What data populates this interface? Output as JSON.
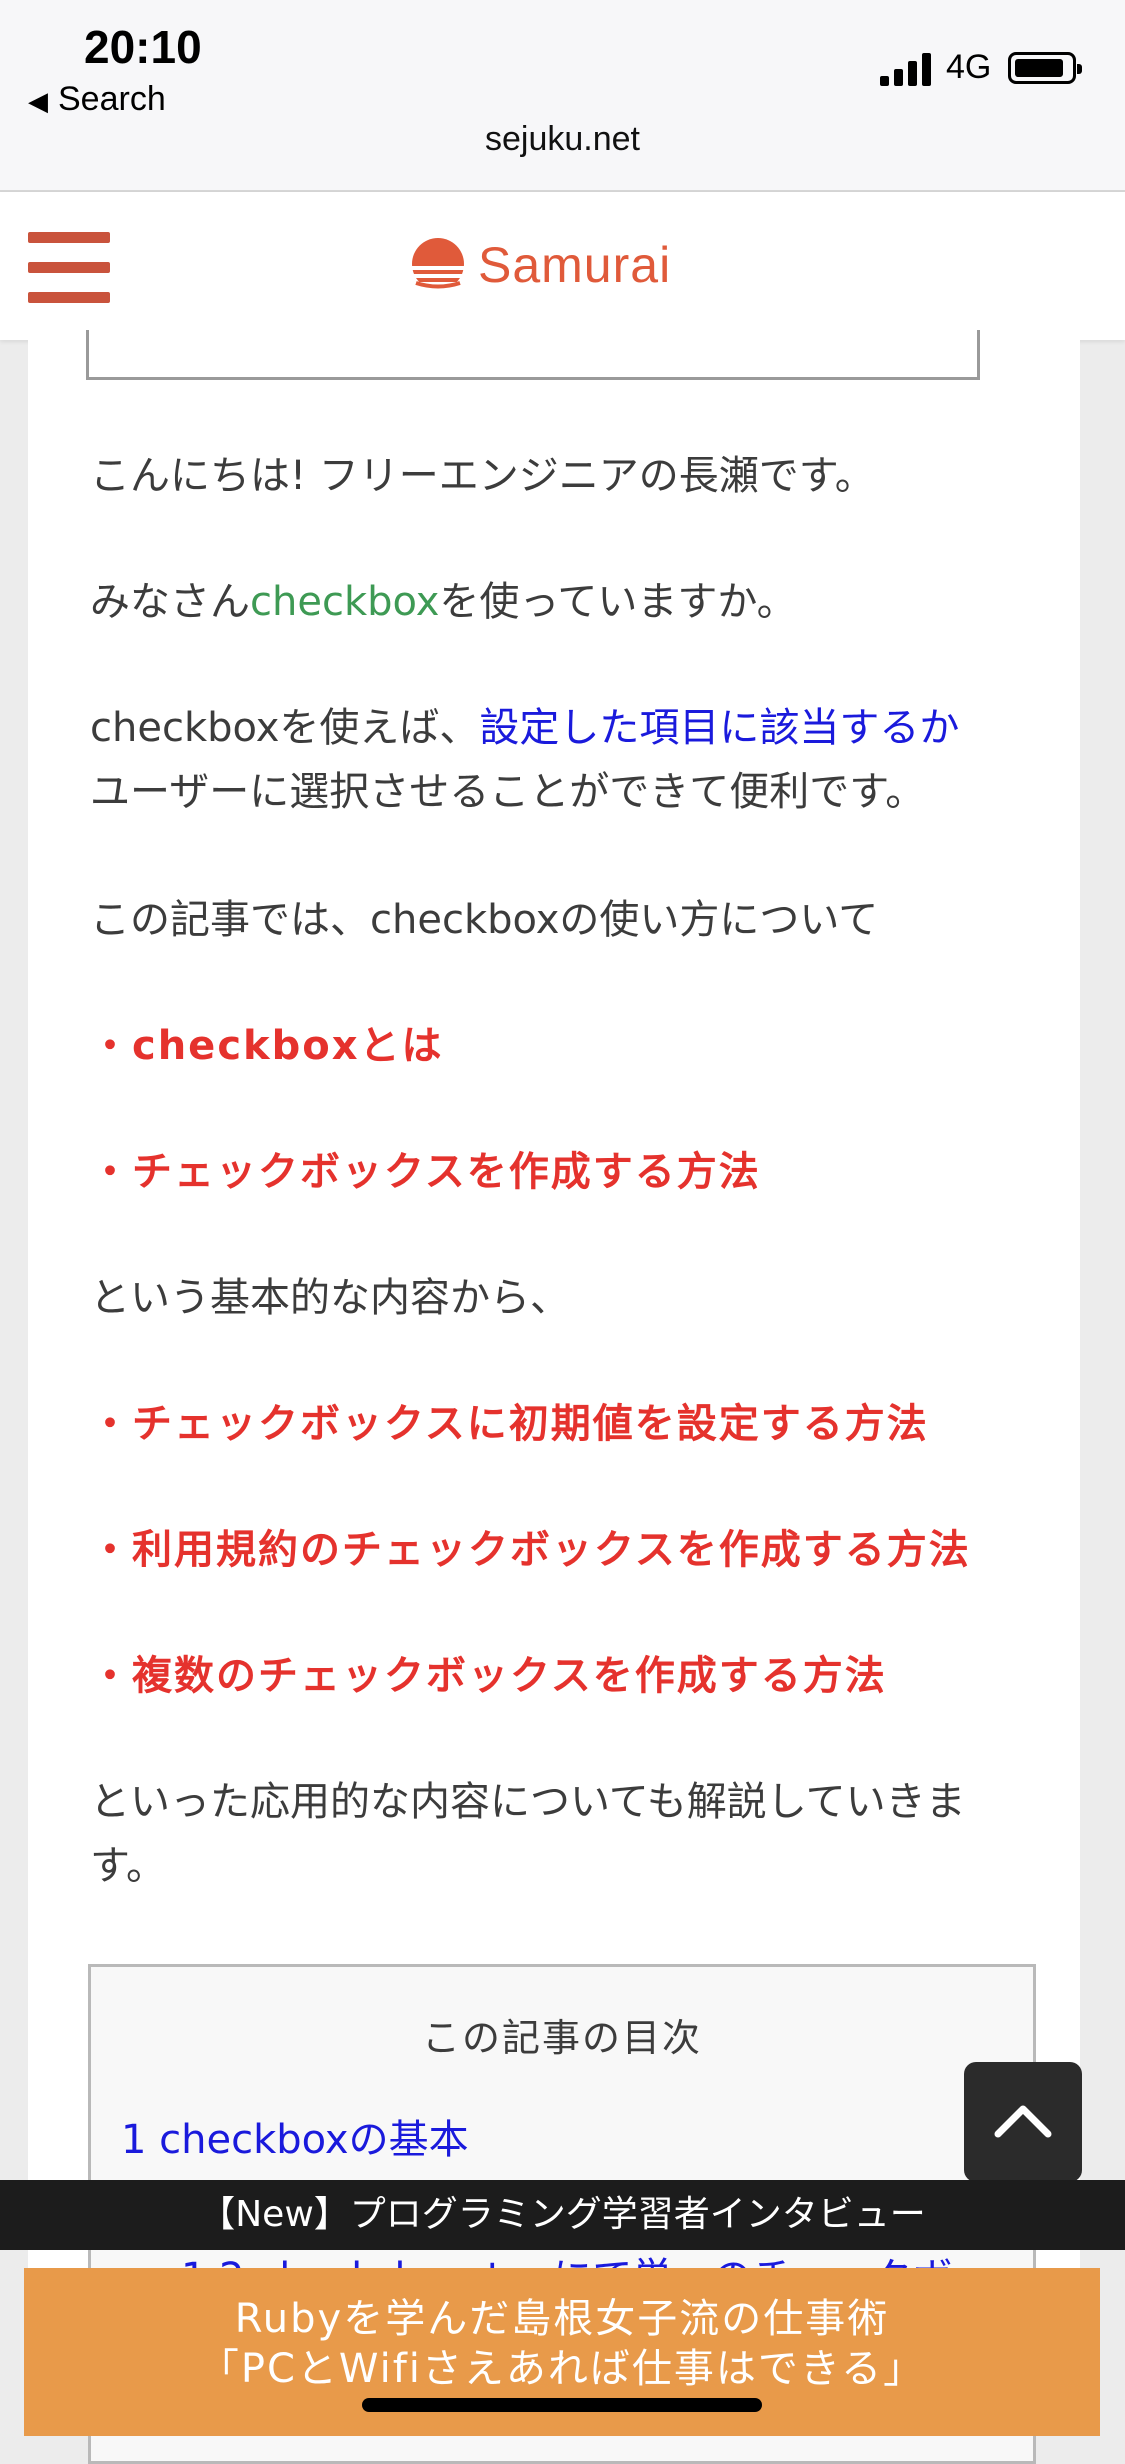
{
  "status": {
    "time": "20:10",
    "back_label": "Search",
    "network": "4G"
  },
  "browser": {
    "url": "sejuku.net"
  },
  "site": {
    "logo_text": "Samurai",
    "brand_color": "#e05a3a"
  },
  "article": {
    "greeting": "こんにちは! フリーエンジニアの長瀬です。",
    "q_prefix": "みなさん",
    "q_link": "checkbox",
    "q_suffix": "を使っていますか。",
    "p3_prefix": "checkboxを使えば、",
    "p3_highlight": "設定した項目に該当するか",
    "p3_line2": "ユーザーに選択させることができて便利です。",
    "intro": "この記事では、checkboxの使い方について",
    "basic_items": [
      "・checkboxとは",
      "・チェックボックスを作成する方法"
    ],
    "basic_outro": "という基本的な内容から、",
    "advanced_items": [
      "・チェックボックスに初期値を設定する方法",
      "・利用規約のチェックボックスを作成する方法",
      "・複数のチェックボックスを作成する方法"
    ],
    "closing_line1": "といった応用的な内容についても解説していきま",
    "closing_line2": "す。"
  },
  "toc": {
    "title": "この記事の目次",
    "items": [
      "1 checkboxの基本",
      "1.2 check_box_tagにて単一のチェックボッ"
    ]
  },
  "banners": {
    "new_bar": "【New】プログラミング学習者インタビュー",
    "ad_line1": "Rubyを学んだ島根女子流の仕事術",
    "ad_line2": "「PCとWifiさえあれば仕事はできる」"
  }
}
